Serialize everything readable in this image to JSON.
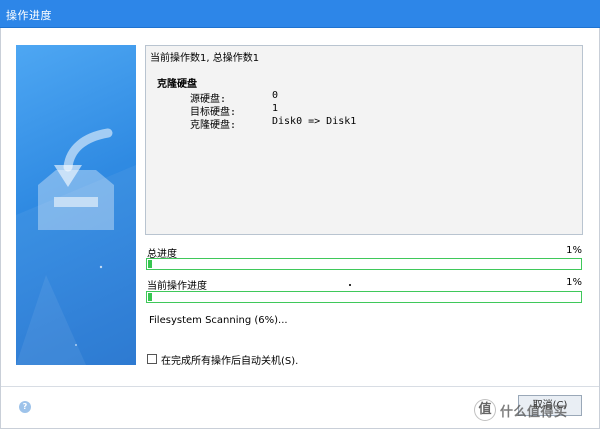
{
  "window": {
    "title": "操作进度"
  },
  "details": {
    "summary": "当前操作数1, 总操作数1",
    "section_heading": "克隆硬盘",
    "rows": [
      {
        "key": "源硬盘:",
        "value": "0"
      },
      {
        "key": "目标硬盘:",
        "value": "1"
      },
      {
        "key": "克隆硬盘:",
        "value": "Disk0 => Disk1"
      }
    ]
  },
  "progress": {
    "total": {
      "label": "总进度",
      "percent_text": "1%",
      "value": 0.01
    },
    "current": {
      "label": "当前操作进度",
      "percent_text": "1%",
      "value": 0.01
    }
  },
  "status": {
    "text": "Filesystem Scanning (6%)..."
  },
  "shutdown": {
    "label": "在完成所有操作后自动关机(S).",
    "checked": false
  },
  "footer": {
    "help_icon": "question-icon",
    "cancel_label": "取消(C)"
  },
  "watermark": {
    "text": "什么值得买",
    "badge": "值"
  },
  "colors": {
    "titlebar": "#2d86e8",
    "progress_fill": "#37c650",
    "side_art": "#2f8ae2"
  }
}
